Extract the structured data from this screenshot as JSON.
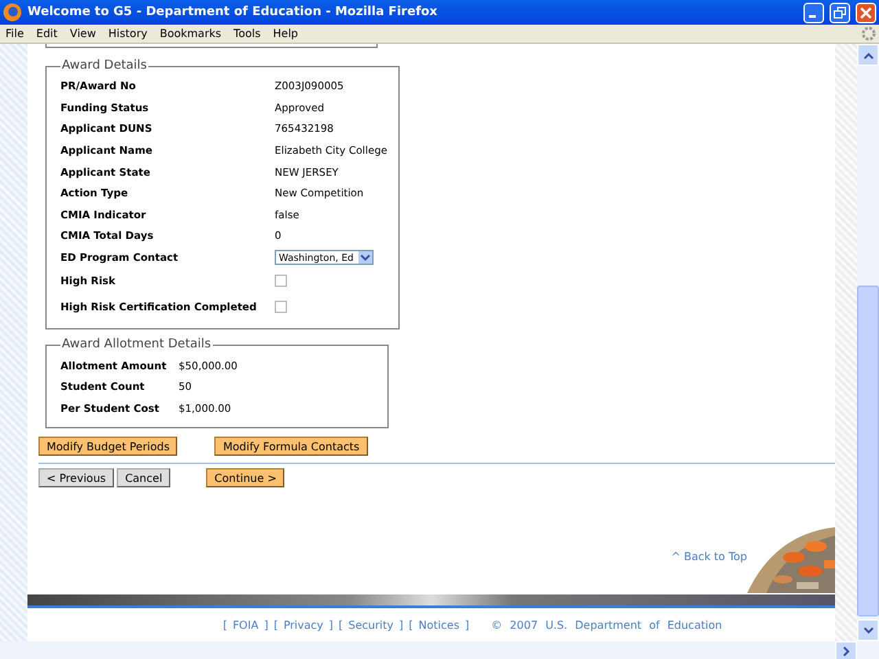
{
  "window": {
    "title": "Welcome to G5 - Department of Education - Mozilla Firefox"
  },
  "menu": [
    "File",
    "Edit",
    "View",
    "History",
    "Bookmarks",
    "Tools",
    "Help"
  ],
  "award_details": {
    "legend": "Award Details",
    "rows": [
      {
        "kind": "text",
        "label": "PR/Award No",
        "value": "Z003J090005"
      },
      {
        "kind": "text",
        "label": "Funding Status",
        "value": "Approved"
      },
      {
        "kind": "text",
        "label": "Applicant DUNS",
        "value": "765432198"
      },
      {
        "kind": "text",
        "label": "Applicant Name",
        "value": "Elizabeth City College"
      },
      {
        "kind": "text",
        "label": "Applicant State",
        "value": "NEW JERSEY"
      },
      {
        "kind": "text",
        "label": "Action Type",
        "value": "New Competition"
      },
      {
        "kind": "text",
        "label": "CMIA Indicator",
        "value": "false"
      },
      {
        "kind": "text",
        "label": "CMIA Total Days",
        "value": "0"
      },
      {
        "kind": "select",
        "label": "ED Program Contact",
        "value": "Washington, Ed"
      },
      {
        "kind": "checkbox",
        "label": "High Risk",
        "checked": false
      },
      {
        "kind": "checkbox",
        "label": "High Risk Certification Completed",
        "checked": false
      }
    ]
  },
  "allotment": {
    "legend": "Award Allotment Details",
    "rows": [
      {
        "label": "Allotment Amount",
        "value": "$50,000.00"
      },
      {
        "label": "Student Count",
        "value": "50"
      },
      {
        "label": "Per Student Cost",
        "value": "$1,000.00"
      }
    ]
  },
  "action_buttons": [
    "Modify Budget Periods",
    "Modify Formula Contacts"
  ],
  "nav_buttons": [
    {
      "kind": "plain",
      "label": "< Previous"
    },
    {
      "kind": "plain",
      "label": "Cancel"
    },
    {
      "kind": "primary",
      "label": "Continue >"
    }
  ],
  "back_to_top": "^ Back to Top",
  "footer": {
    "links": [
      "FOIA",
      "Privacy",
      "Security",
      "Notices"
    ],
    "open_bracket": "[",
    "close_bracket": "]",
    "copyright": "© 2007 U.S. Department of Education"
  }
}
